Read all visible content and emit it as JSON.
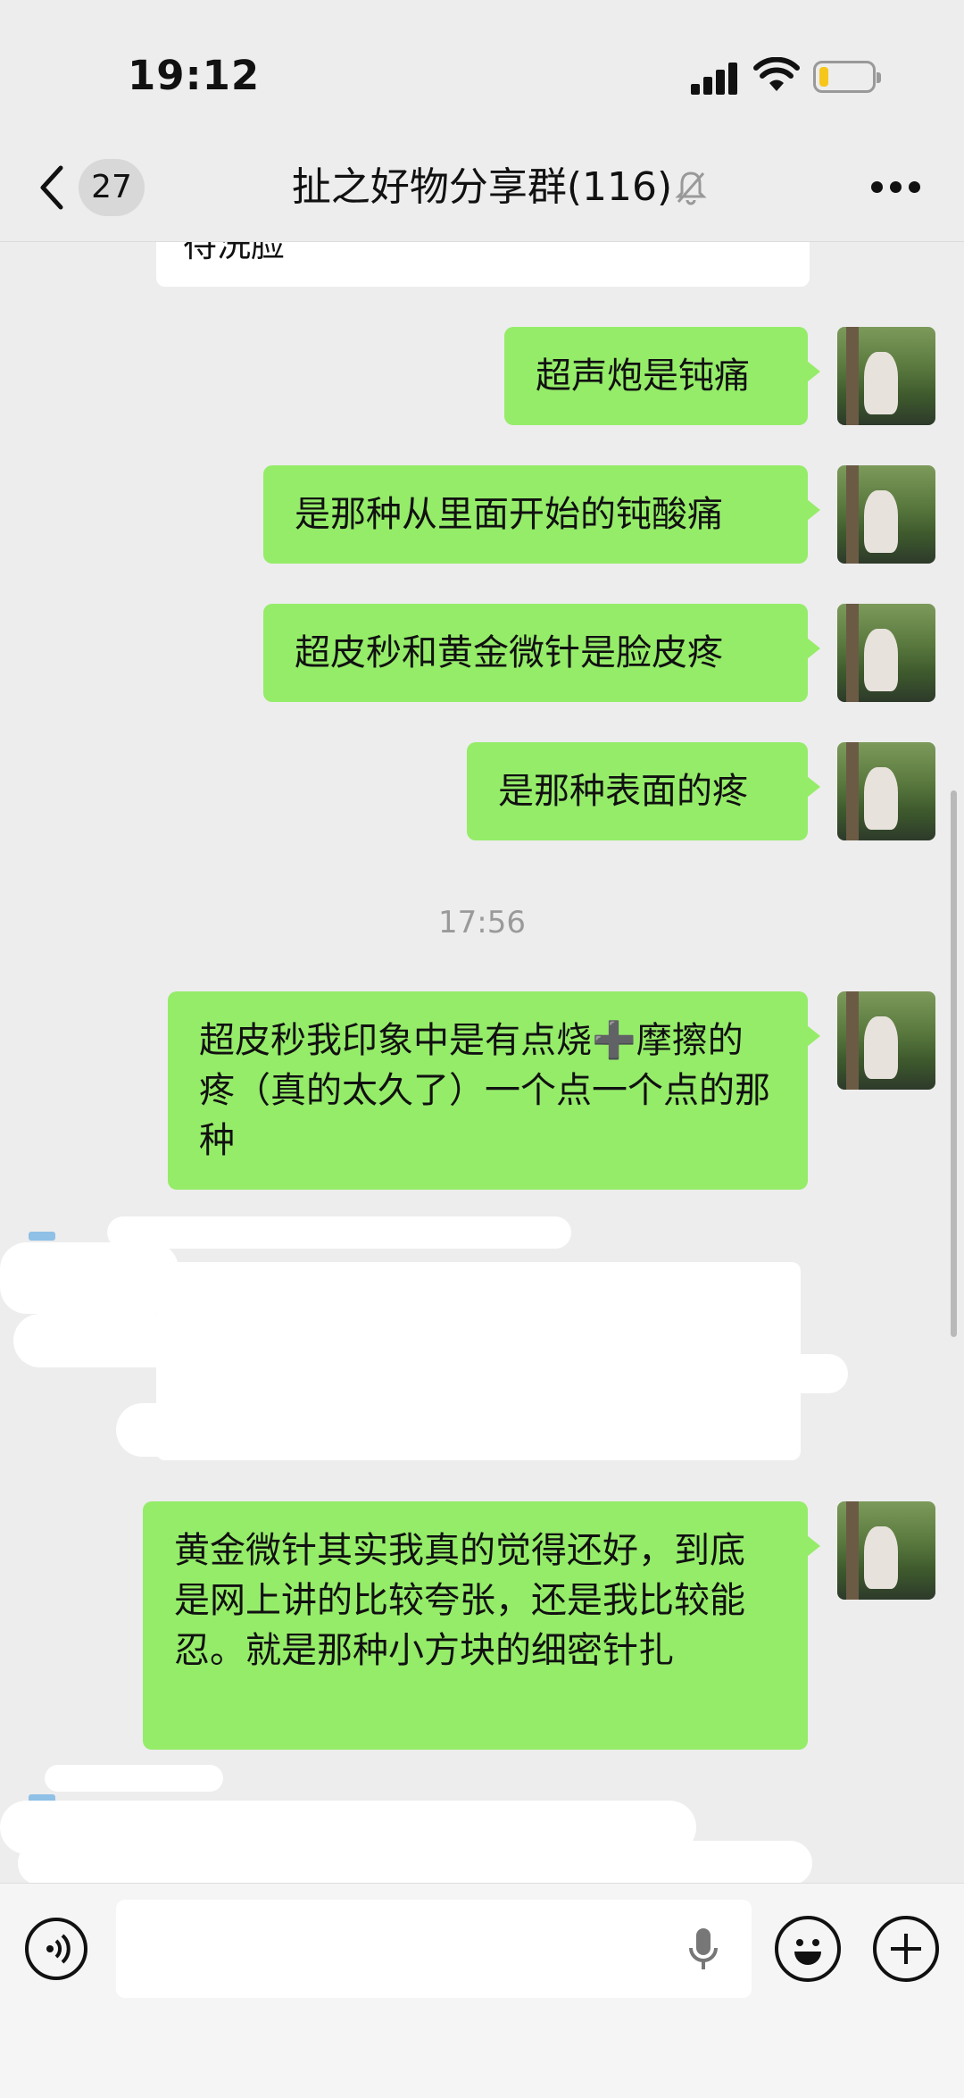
{
  "status_bar": {
    "time": "19:12",
    "battery_level": 0.15,
    "battery_color": "#f7c61b"
  },
  "nav": {
    "unread_count": "27",
    "title": "扯之好物分享群(116)",
    "muted": true
  },
  "chat": {
    "partial_text": "待洗脸",
    "messages": [
      {
        "text": "超声炮是钝痛"
      },
      {
        "text": "是那种从里面开始的钝酸痛"
      },
      {
        "text": "超皮秒和黄金微针是脸皮疼"
      },
      {
        "text": "是那种表面的疼"
      },
      {
        "text": "超皮秒我印象中是有点烧➕摩擦的疼（真的太久了）一个点一个点的那种"
      },
      {
        "text": "黄金微针其实我真的觉得还好，到底是网上讲的比较夸张，还是我比较能忍。就是那种小方块的细密针扎"
      }
    ],
    "timestamp": "17:56"
  },
  "input": {
    "value": ""
  },
  "colors": {
    "bubble_green": "#95ec69",
    "background": "#ededed"
  },
  "icons": [
    "back-icon",
    "mute-icon",
    "more-icon",
    "voice-icon",
    "mic-icon",
    "emoji-icon",
    "plus-icon"
  ]
}
